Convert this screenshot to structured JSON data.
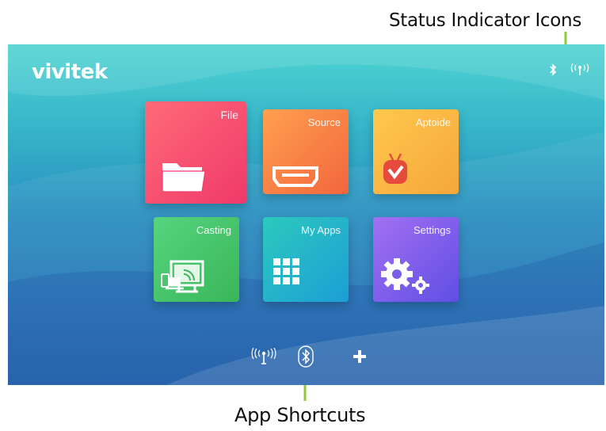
{
  "callouts": {
    "status": "Status Indicator Icons",
    "shortcuts": "App Shortcuts"
  },
  "brand": {
    "logo": "vivitek"
  },
  "status_bar": {
    "icons": [
      "bluetooth-icon",
      "wifi-broadcast-icon"
    ]
  },
  "tiles": [
    {
      "label": "File",
      "icon": "folder-icon",
      "color_from": "#ff5c72",
      "color_to": "#f03a6a"
    },
    {
      "label": "Source",
      "icon": "hdmi-port-icon",
      "color_from": "#ff9a4d",
      "color_to": "#f26b3e"
    },
    {
      "label": "Aptoide",
      "icon": "aptoide-icon",
      "color_from": "#ffc24a",
      "color_to": "#f7a73b"
    },
    {
      "label": "Casting",
      "icon": "screen-cast-icon",
      "color_from": "#4fd07a",
      "color_to": "#3ab85c"
    },
    {
      "label": "My Apps",
      "icon": "app-grid-icon",
      "color_from": "#28c6c0",
      "color_to": "#1aa3d2"
    },
    {
      "label": "Settings",
      "icon": "gears-icon",
      "color_from": "#9b6cf0",
      "color_to": "#6a53e6"
    }
  ],
  "shortcuts": [
    "wifi-icon",
    "bluetooth-icon",
    "add-icon"
  ],
  "colors": {
    "bracket": "#93c83e",
    "screen_top": "#4fd4d2",
    "screen_bottom": "#2063ad"
  }
}
